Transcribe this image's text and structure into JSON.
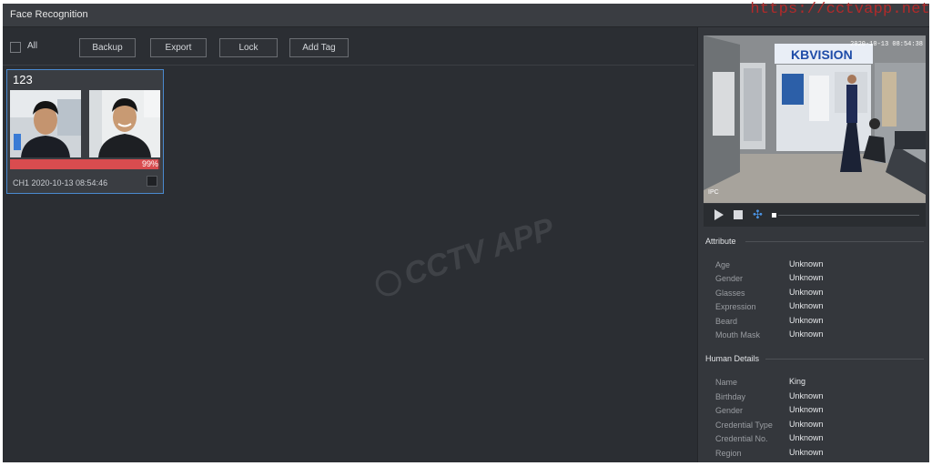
{
  "app": {
    "title": "Face Recognition"
  },
  "watermark": {
    "url": "https://cctvapp.net",
    "logo_text": "CCTV APP"
  },
  "toolbar": {
    "all_label": "All",
    "backup_label": "Backup",
    "export_label": "Export",
    "lock_label": "Lock",
    "add_tag_label": "Add Tag"
  },
  "results": [
    {
      "name": "123",
      "similarity_text": "99%",
      "similarity": 0.99,
      "meta": "CH1 2020-10-13 08:54:46"
    }
  ],
  "video": {
    "timestamp": "2020-10-13 08:54:38",
    "corner_label": "IPC",
    "store_sign": "KBVISION"
  },
  "player": {
    "icons": [
      "play-icon",
      "stop-icon",
      "speed-icon"
    ]
  },
  "attribute": {
    "title": "Attribute",
    "rows": [
      {
        "label": "Age",
        "value": "Unknown"
      },
      {
        "label": "Gender",
        "value": "Unknown"
      },
      {
        "label": "Glasses",
        "value": "Unknown"
      },
      {
        "label": "Expression",
        "value": "Unknown"
      },
      {
        "label": "Beard",
        "value": "Unknown"
      },
      {
        "label": "Mouth Mask",
        "value": "Unknown"
      }
    ]
  },
  "human": {
    "title": "Human Details",
    "rows": [
      {
        "label": "Name",
        "value": "King"
      },
      {
        "label": "Birthday",
        "value": "Unknown"
      },
      {
        "label": "Gender",
        "value": "Unknown"
      },
      {
        "label": "Credential Type",
        "value": "Unknown"
      },
      {
        "label": "Credential No.",
        "value": "Unknown"
      },
      {
        "label": "Region",
        "value": "Unknown"
      }
    ]
  },
  "colors": {
    "accent": "#4a8ad0",
    "similarity_bar": "#d94c4f",
    "watermark_url": "#b22a2a"
  }
}
